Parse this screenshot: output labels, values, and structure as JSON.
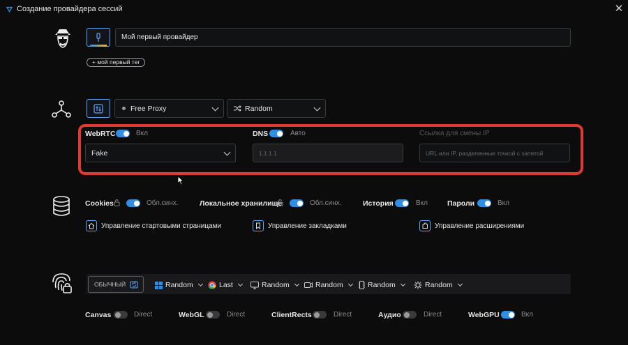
{
  "window": {
    "title": "Создание провайдера сессий"
  },
  "profile": {
    "name_value": "Мой первый провайдер",
    "tag_label": "+ мой первый тег"
  },
  "proxy": {
    "proxy_select": "Free Proxy",
    "rotation_select": "Random"
  },
  "network": {
    "webrtc": {
      "label": "WebRTC",
      "state": "Вкл",
      "mode": "Fake"
    },
    "dns": {
      "label": "DNS",
      "state": "Авто",
      "placeholder": "1.1.1.1"
    },
    "ip_change": {
      "label": "Ссылка для смены IP",
      "placeholder": "URL или IP, разделенные точкой с запятой"
    }
  },
  "storage": {
    "items": [
      {
        "label": "Cookies",
        "state": "Обл.синх."
      },
      {
        "label": "Локальное хранилище",
        "state": "Обл.синх."
      },
      {
        "label": "История",
        "state": "Вкл"
      },
      {
        "label": "Пароли",
        "state": "Вкл"
      }
    ],
    "links": [
      "Управление стартовыми страницами",
      "Управление закладками",
      "Управление расширениями"
    ]
  },
  "fingerprint": {
    "mode_label": "ОБЫЧНЫЙ",
    "options": [
      "Random",
      "Last",
      "Random",
      "Random",
      "Random",
      "Random"
    ],
    "toggles": [
      {
        "label": "Canvas",
        "state": "Direct",
        "on": false
      },
      {
        "label": "WebGL",
        "state": "Direct",
        "on": false
      },
      {
        "label": "ClientRects",
        "state": "Direct",
        "on": false
      },
      {
        "label": "Аудио",
        "state": "Direct",
        "on": false
      },
      {
        "label": "WebGPU",
        "state": "Вкл",
        "on": true
      }
    ]
  },
  "colors": {
    "accent": "#2f8ee6",
    "highlight": "#e0392f",
    "background": "#0c0c0d"
  },
  "icons": [
    "app-logo-icon",
    "close-icon",
    "hacker-avatar-icon",
    "pin-icon",
    "network-nodes-icon",
    "proxy-swap-icon",
    "shuffle-icon",
    "database-icon",
    "lock-icon",
    "home-icon",
    "bookmark-icon",
    "extension-icon",
    "fingerprint-lock-icon",
    "refresh-icon",
    "windows-icon",
    "chrome-icon",
    "monitor-icon",
    "camera-icon",
    "memory-icon",
    "cpu-icon"
  ]
}
